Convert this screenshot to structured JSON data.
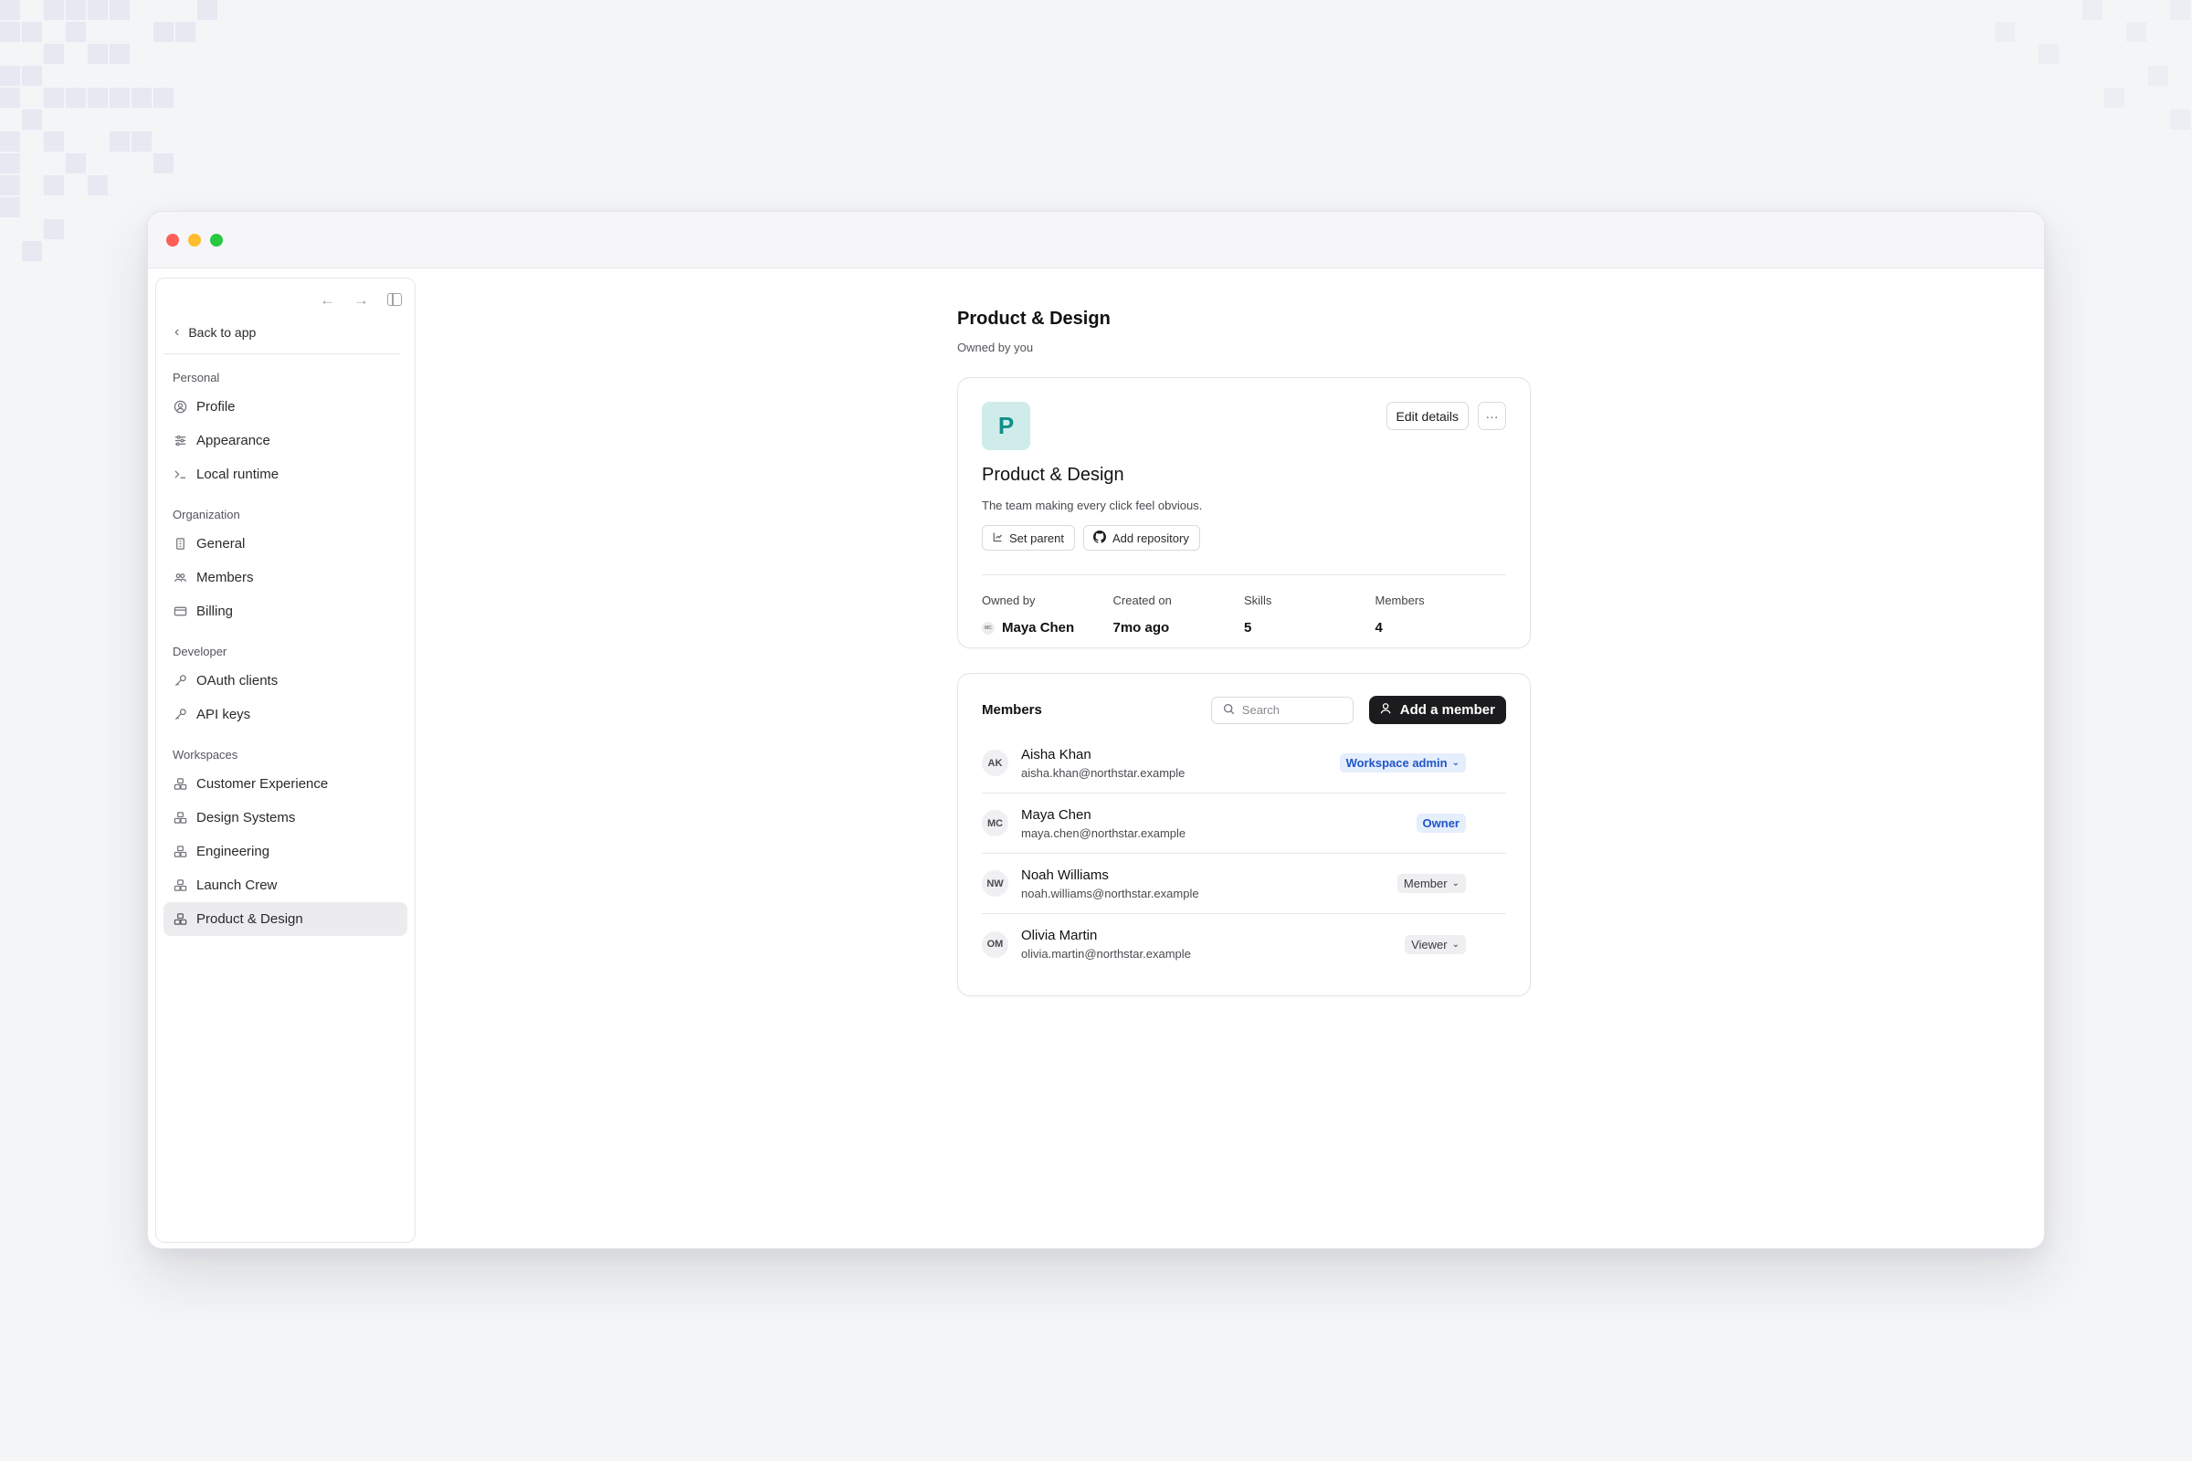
{
  "sidebar": {
    "back_label": "Back to app",
    "groups": [
      {
        "title": "Personal",
        "items": [
          {
            "label": "Profile",
            "icon": "user-circle-icon"
          },
          {
            "label": "Appearance",
            "icon": "sliders-icon"
          },
          {
            "label": "Local runtime",
            "icon": "terminal-icon"
          }
        ]
      },
      {
        "title": "Organization",
        "items": [
          {
            "label": "General",
            "icon": "building-icon"
          },
          {
            "label": "Members",
            "icon": "users-icon"
          },
          {
            "label": "Billing",
            "icon": "credit-card-icon"
          }
        ]
      },
      {
        "title": "Developer",
        "items": [
          {
            "label": "OAuth clients",
            "icon": "key-icon"
          },
          {
            "label": "API keys",
            "icon": "key-icon"
          }
        ]
      },
      {
        "title": "Workspaces",
        "items": [
          {
            "label": "Customer Experience",
            "icon": "workspace-icon"
          },
          {
            "label": "Design Systems",
            "icon": "workspace-icon"
          },
          {
            "label": "Engineering",
            "icon": "workspace-icon"
          },
          {
            "label": "Launch Crew",
            "icon": "workspace-icon"
          },
          {
            "label": "Product & Design",
            "icon": "workspace-icon",
            "active": true
          }
        ]
      }
    ]
  },
  "header": {
    "title": "Product & Design",
    "subtitle": "Owned by you"
  },
  "team_card": {
    "avatar_letter": "P",
    "edit_label": "Edit details",
    "more_label": "···",
    "name": "Product & Design",
    "description": "The team making every click feel obvious.",
    "set_parent_label": "Set parent",
    "add_repo_label": "Add repository",
    "stats": {
      "owned_by_label": "Owned by",
      "owner_initials": "MC",
      "owner_name": "Maya Chen",
      "created_label": "Created on",
      "created_value": "7mo ago",
      "skills_label": "Skills",
      "skills_value": "5",
      "members_label": "Members",
      "members_value": "4"
    }
  },
  "members": {
    "title": "Members",
    "search_placeholder": "Search",
    "add_label": "Add a member",
    "rows": [
      {
        "initials": "AK",
        "name": "Aisha Khan",
        "email": "aisha.khan@northstar.example",
        "role": "Workspace admin",
        "dropdown": true,
        "style": "blue"
      },
      {
        "initials": "MC",
        "name": "Maya Chen",
        "email": "maya.chen@northstar.example",
        "role": "Owner",
        "dropdown": false,
        "style": "blue"
      },
      {
        "initials": "NW",
        "name": "Noah Williams",
        "email": "noah.williams@northstar.example",
        "role": "Member",
        "dropdown": true,
        "style": "gray"
      },
      {
        "initials": "OM",
        "name": "Olivia Martin",
        "email": "olivia.martin@northstar.example",
        "role": "Viewer",
        "dropdown": true,
        "style": "gray"
      }
    ]
  },
  "colors": {
    "accent_teal": "#0f8f88",
    "role_blue": "#1f55c8",
    "dark_button": "#1c1c1e"
  }
}
